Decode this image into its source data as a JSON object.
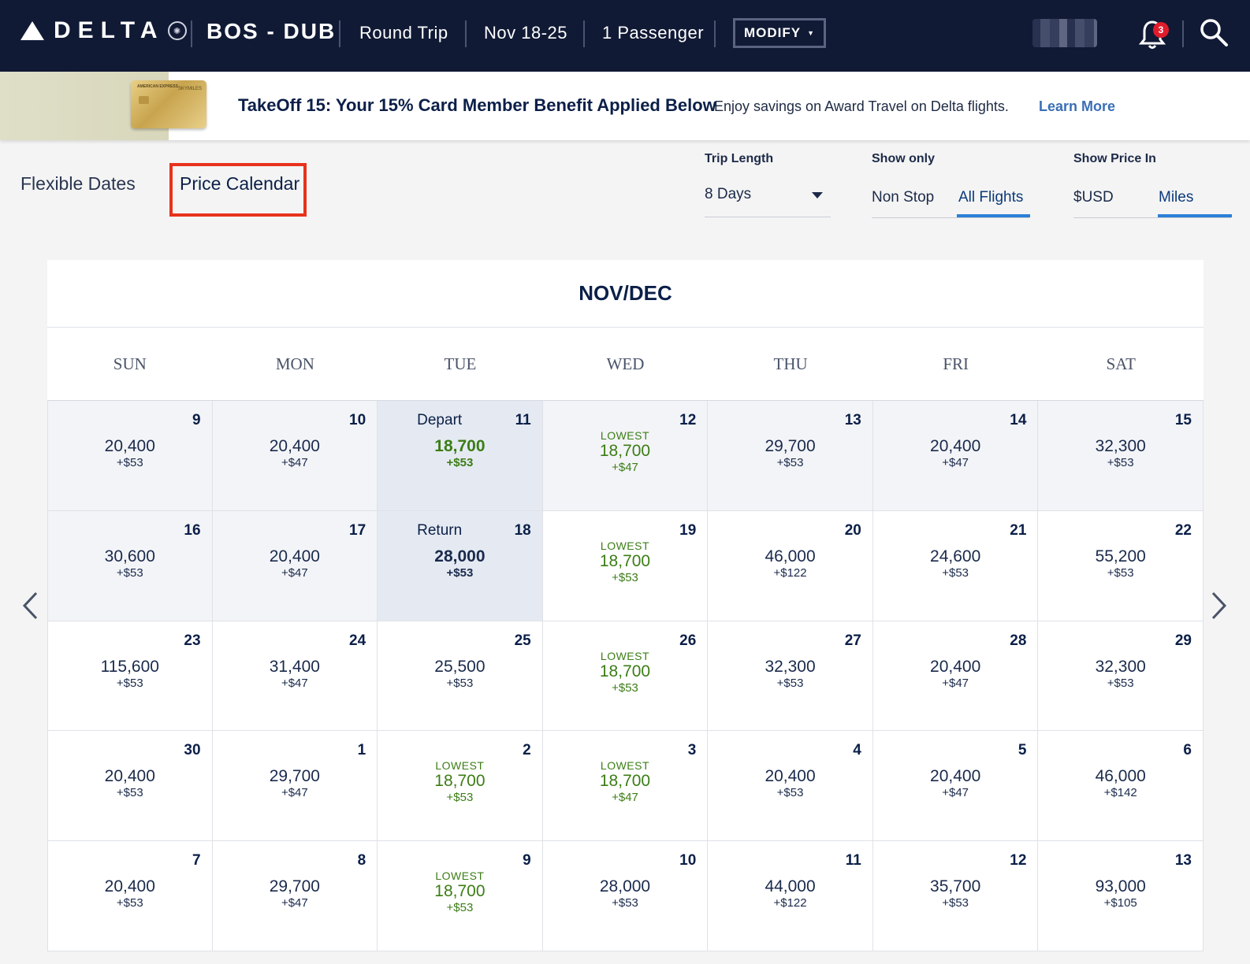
{
  "header": {
    "logo_text": "DELTA",
    "route": "BOS - DUB",
    "trip_type": "Round Trip",
    "dates": "Nov 18-25",
    "passengers": "1 Passenger",
    "modify_label": "MODIFY",
    "notifications_count": "3",
    "icons": [
      "delta-logo-icon",
      "bell-icon",
      "search-icon",
      "chevron-down-icon"
    ]
  },
  "promo": {
    "title": "TakeOff 15: Your 15% Card Member Benefit Applied Below",
    "subtitle": "Enjoy savings on Award Travel on Delta flights.",
    "link": "Learn More"
  },
  "tabs": {
    "flexible": "Flexible Dates",
    "price_calendar": "Price Calendar",
    "active": "Price Calendar"
  },
  "filters": {
    "trip_length": {
      "label": "Trip Length",
      "value": "8 Days"
    },
    "show_only": {
      "label": "Show only",
      "options": [
        "Non Stop",
        "All Flights"
      ],
      "selected": "All Flights"
    },
    "show_price_in": {
      "label": "Show Price In",
      "options": [
        "$USD",
        "Miles"
      ],
      "selected": "Miles"
    }
  },
  "calendar": {
    "title": "NOV/DEC",
    "days_of_week": [
      "SUN",
      "MON",
      "TUE",
      "WED",
      "THU",
      "FRI",
      "SAT"
    ],
    "lowest_label": "LOWEST",
    "weeks": [
      [
        {
          "day": "9",
          "miles": "20,400",
          "fee": "+$53",
          "shade": true
        },
        {
          "day": "10",
          "miles": "20,400",
          "fee": "+$47",
          "shade": true
        },
        {
          "day": "11",
          "miles": "18,700",
          "fee": "+$53",
          "tag": "Depart",
          "selected": true,
          "green": true
        },
        {
          "day": "12",
          "miles": "18,700",
          "fee": "+$47",
          "lowest": true,
          "shade": true
        },
        {
          "day": "13",
          "miles": "29,700",
          "fee": "+$53",
          "shade": true
        },
        {
          "day": "14",
          "miles": "20,400",
          "fee": "+$47",
          "shade": true
        },
        {
          "day": "15",
          "miles": "32,300",
          "fee": "+$53",
          "shade": true
        }
      ],
      [
        {
          "day": "16",
          "miles": "30,600",
          "fee": "+$53",
          "shade": true
        },
        {
          "day": "17",
          "miles": "20,400",
          "fee": "+$47",
          "shade": true
        },
        {
          "day": "18",
          "miles": "28,000",
          "fee": "+$53",
          "tag": "Return",
          "selected": true
        },
        {
          "day": "19",
          "miles": "18,700",
          "fee": "+$53",
          "lowest": true
        },
        {
          "day": "20",
          "miles": "46,000",
          "fee": "+$122"
        },
        {
          "day": "21",
          "miles": "24,600",
          "fee": "+$53"
        },
        {
          "day": "22",
          "miles": "55,200",
          "fee": "+$53"
        }
      ],
      [
        {
          "day": "23",
          "miles": "115,600",
          "fee": "+$53"
        },
        {
          "day": "24",
          "miles": "31,400",
          "fee": "+$47"
        },
        {
          "day": "25",
          "miles": "25,500",
          "fee": "+$53"
        },
        {
          "day": "26",
          "miles": "18,700",
          "fee": "+$53",
          "lowest": true
        },
        {
          "day": "27",
          "miles": "32,300",
          "fee": "+$53"
        },
        {
          "day": "28",
          "miles": "20,400",
          "fee": "+$47"
        },
        {
          "day": "29",
          "miles": "32,300",
          "fee": "+$53"
        }
      ],
      [
        {
          "day": "30",
          "miles": "20,400",
          "fee": "+$53"
        },
        {
          "day": "1",
          "miles": "29,700",
          "fee": "+$47"
        },
        {
          "day": "2",
          "miles": "18,700",
          "fee": "+$53",
          "lowest": true
        },
        {
          "day": "3",
          "miles": "18,700",
          "fee": "+$47",
          "lowest": true
        },
        {
          "day": "4",
          "miles": "20,400",
          "fee": "+$53"
        },
        {
          "day": "5",
          "miles": "20,400",
          "fee": "+$47"
        },
        {
          "day": "6",
          "miles": "46,000",
          "fee": "+$142"
        }
      ],
      [
        {
          "day": "7",
          "miles": "20,400",
          "fee": "+$53"
        },
        {
          "day": "8",
          "miles": "29,700",
          "fee": "+$47"
        },
        {
          "day": "9",
          "miles": "18,700",
          "fee": "+$53",
          "lowest": true
        },
        {
          "day": "10",
          "miles": "28,000",
          "fee": "+$53"
        },
        {
          "day": "11",
          "miles": "44,000",
          "fee": "+$122"
        },
        {
          "day": "12",
          "miles": "35,700",
          "fee": "+$53"
        },
        {
          "day": "13",
          "miles": "93,000",
          "fee": "+$105"
        }
      ]
    ]
  },
  "colors": {
    "header_bg": "#111a35",
    "navy_text": "#0b1f48",
    "lowest_green": "#3c7d16",
    "accent_blue": "#2b7fd6",
    "highlight_red": "#e8321c",
    "selected_bg": "#e5eaf2"
  }
}
